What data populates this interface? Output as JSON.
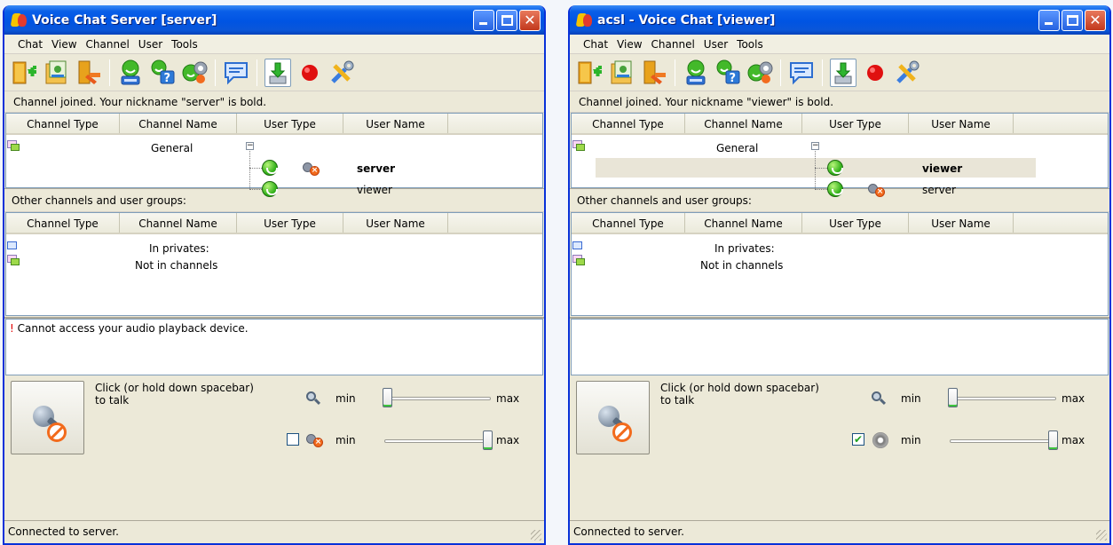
{
  "windows": [
    {
      "title": "Voice Chat Server [server]",
      "menu": [
        "Chat",
        "View",
        "Channel",
        "User",
        "Tools"
      ],
      "status_message": "Channel joined. Your nickname \"server\" is bold.",
      "columns": [
        "Channel Type",
        "Channel Name",
        "User Type",
        "User Name"
      ],
      "channel": {
        "name": "General",
        "users": [
          {
            "name": "server",
            "bold": true,
            "mic_muted": true
          },
          {
            "name": "viewer",
            "bold": false,
            "mic_muted": false
          }
        ]
      },
      "other_label": "Other channels and user groups:",
      "other_columns": [
        "Channel Type",
        "Channel Name",
        "User Type",
        "User Name"
      ],
      "other_rows": [
        "In privates:",
        "Not in channels"
      ],
      "log_prefix": "!",
      "log_text": "Cannot access your audio playback device.",
      "talk_text": "Click (or  hold down spacebar)\nto talk",
      "mic_min": "min",
      "mic_max": "max",
      "mic_level": 0.0,
      "spk_min": "min",
      "spk_max": "max",
      "spk_level": 1.0,
      "spk_checked": false,
      "statusbar": "Connected to server."
    },
    {
      "title": "acsl - Voice Chat [viewer]",
      "menu": [
        "Chat",
        "View",
        "Channel",
        "User",
        "Tools"
      ],
      "status_message": "Channel joined. Your nickname \"viewer\" is bold.",
      "columns": [
        "Channel Type",
        "Channel Name",
        "User Type",
        "User Name"
      ],
      "channel": {
        "name": "General",
        "users": [
          {
            "name": "viewer",
            "bold": true,
            "mic_muted": false
          },
          {
            "name": "server",
            "bold": false,
            "mic_muted": true
          }
        ]
      },
      "other_label": "Other channels and user groups:",
      "other_columns": [
        "Channel Type",
        "Channel Name",
        "User Type",
        "User Name"
      ],
      "other_rows": [
        "In privates:",
        "Not in channels"
      ],
      "log_prefix": "",
      "log_text": "",
      "talk_text": "Click (or  hold down spacebar)\nto talk",
      "mic_min": "min",
      "mic_max": "max",
      "mic_level": 0.0,
      "spk_min": "min",
      "spk_max": "max",
      "spk_level": 1.0,
      "spk_checked": true,
      "statusbar": "Connected to server."
    }
  ],
  "icons": [
    "join-channel-icon",
    "channel-settings-icon",
    "leave-channel-icon",
    "user-info-icon",
    "user-help-icon",
    "user-voice-icon",
    "message-icon",
    "download-icon",
    "record-icon",
    "tools-icon"
  ],
  "colors": {
    "title_blue": "#0054e3",
    "accent_green": "#3dc33d",
    "alert_red": "#e00000"
  }
}
